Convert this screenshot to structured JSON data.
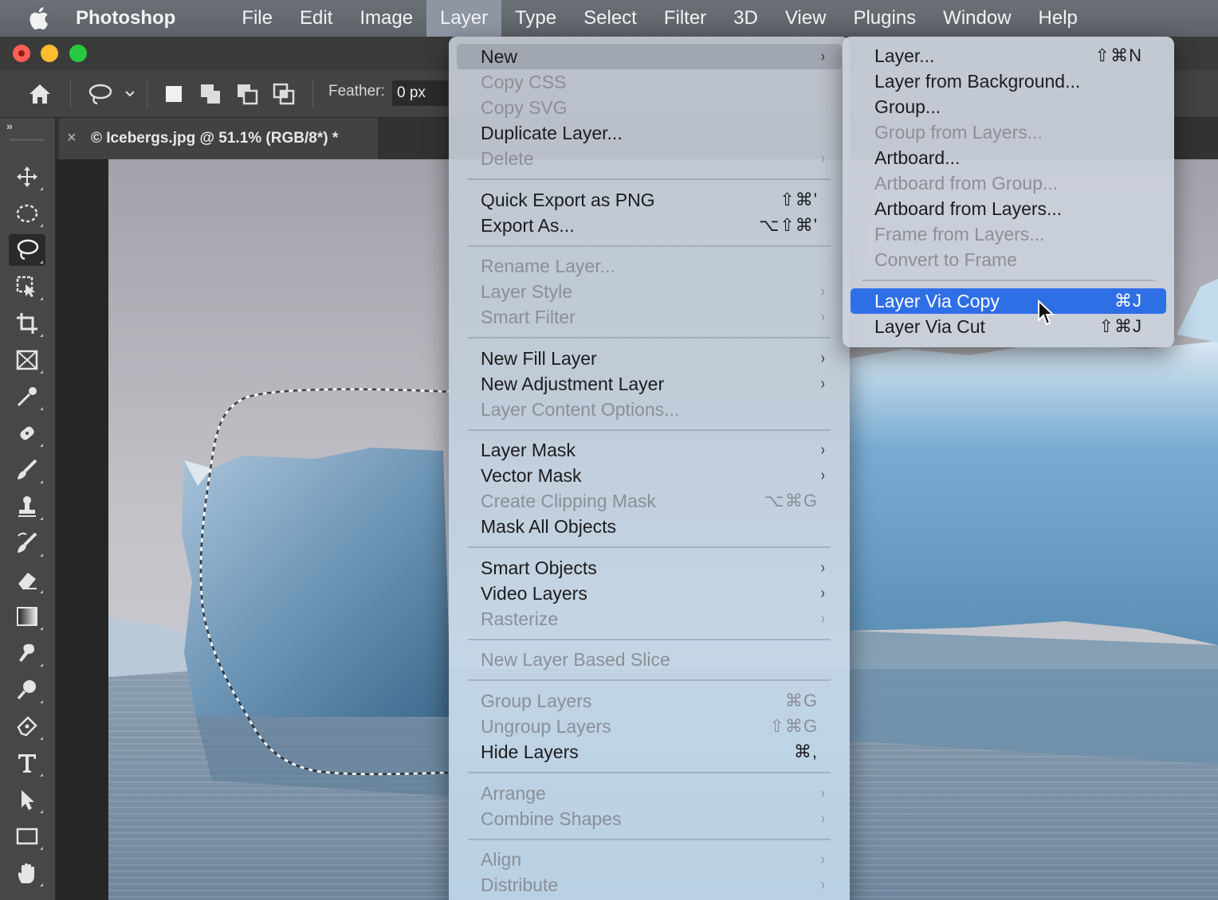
{
  "menubar": {
    "app": "Photoshop",
    "items": [
      "File",
      "Edit",
      "Image",
      "Layer",
      "Type",
      "Select",
      "Filter",
      "3D",
      "View",
      "Plugins",
      "Window",
      "Help"
    ],
    "active": "Layer"
  },
  "options": {
    "feather_label": "Feather:",
    "feather_value": "0 px"
  },
  "document": {
    "tab_title": "© Icebergs.jpg @ 51.1% (RGB/8*) *",
    "close_glyph": "×"
  },
  "toolbar": {
    "collapse_glyph": "»",
    "tools": [
      "move-tool",
      "elliptical-marquee-tool",
      "lasso-tool",
      "object-selection-tool",
      "crop-tool",
      "frame-tool",
      "eyedropper-tool",
      "healing-brush-tool",
      "brush-tool",
      "clone-stamp-tool",
      "history-brush-tool",
      "eraser-tool",
      "gradient-tool",
      "smudge-tool",
      "dodge-tool",
      "pen-tool",
      "type-tool",
      "path-selection-tool",
      "rectangle-tool",
      "hand-tool"
    ],
    "selected": "lasso-tool"
  },
  "layer_menu": {
    "items": [
      {
        "label": "New",
        "submenu": true,
        "hover": true
      },
      {
        "label": "Copy CSS",
        "disabled": true
      },
      {
        "label": "Copy SVG",
        "disabled": true
      },
      {
        "label": "Duplicate Layer..."
      },
      {
        "label": "Delete",
        "disabled": true,
        "submenu": true
      },
      {
        "label": "Quick Export as PNG",
        "shortcut": "⇧⌘'"
      },
      {
        "label": "Export As...",
        "shortcut": "⌥⇧⌘'"
      },
      {
        "label": "Rename Layer...",
        "disabled": true
      },
      {
        "label": "Layer Style",
        "disabled": true,
        "submenu": true
      },
      {
        "label": "Smart Filter",
        "disabled": true,
        "submenu": true
      },
      {
        "label": "New Fill Layer",
        "submenu": true
      },
      {
        "label": "New Adjustment Layer",
        "submenu": true
      },
      {
        "label": "Layer Content Options...",
        "disabled": true
      },
      {
        "label": "Layer Mask",
        "submenu": true
      },
      {
        "label": "Vector Mask",
        "submenu": true
      },
      {
        "label": "Create Clipping Mask",
        "disabled": true,
        "shortcut": "⌥⌘G"
      },
      {
        "label": "Mask All Objects"
      },
      {
        "label": "Smart Objects",
        "submenu": true
      },
      {
        "label": "Video Layers",
        "submenu": true
      },
      {
        "label": "Rasterize",
        "disabled": true,
        "submenu": true
      },
      {
        "label": "New Layer Based Slice",
        "disabled": true
      },
      {
        "label": "Group Layers",
        "disabled": true,
        "shortcut": "⌘G"
      },
      {
        "label": "Ungroup Layers",
        "disabled": true,
        "shortcut": "⇧⌘G"
      },
      {
        "label": "Hide Layers",
        "shortcut": "⌘,"
      },
      {
        "label": "Arrange",
        "disabled": true,
        "submenu": true
      },
      {
        "label": "Combine Shapes",
        "disabled": true,
        "submenu": true
      },
      {
        "label": "Align",
        "disabled": true,
        "submenu": true
      },
      {
        "label": "Distribute",
        "disabled": true,
        "submenu": true
      }
    ]
  },
  "new_submenu": {
    "items": [
      {
        "label": "Layer...",
        "shortcut": "⇧⌘N"
      },
      {
        "label": "Layer from Background..."
      },
      {
        "label": "Group..."
      },
      {
        "label": "Group from Layers...",
        "disabled": true
      },
      {
        "label": "Artboard..."
      },
      {
        "label": "Artboard from Group...",
        "disabled": true
      },
      {
        "label": "Artboard from Layers..."
      },
      {
        "label": "Frame from Layers...",
        "disabled": true
      },
      {
        "label": "Convert to Frame",
        "disabled": true
      },
      {
        "label": "Layer Via Copy",
        "shortcut": "⌘J",
        "highlighted": true
      },
      {
        "label": "Layer Via Cut",
        "shortcut": "⇧⌘J"
      }
    ]
  },
  "chevron_glyph": "›",
  "colors": {
    "highlight": "#2f6fe6",
    "menubar": "#62666d",
    "sky": "#b9b8bf",
    "ice": "#7fa9c7"
  }
}
